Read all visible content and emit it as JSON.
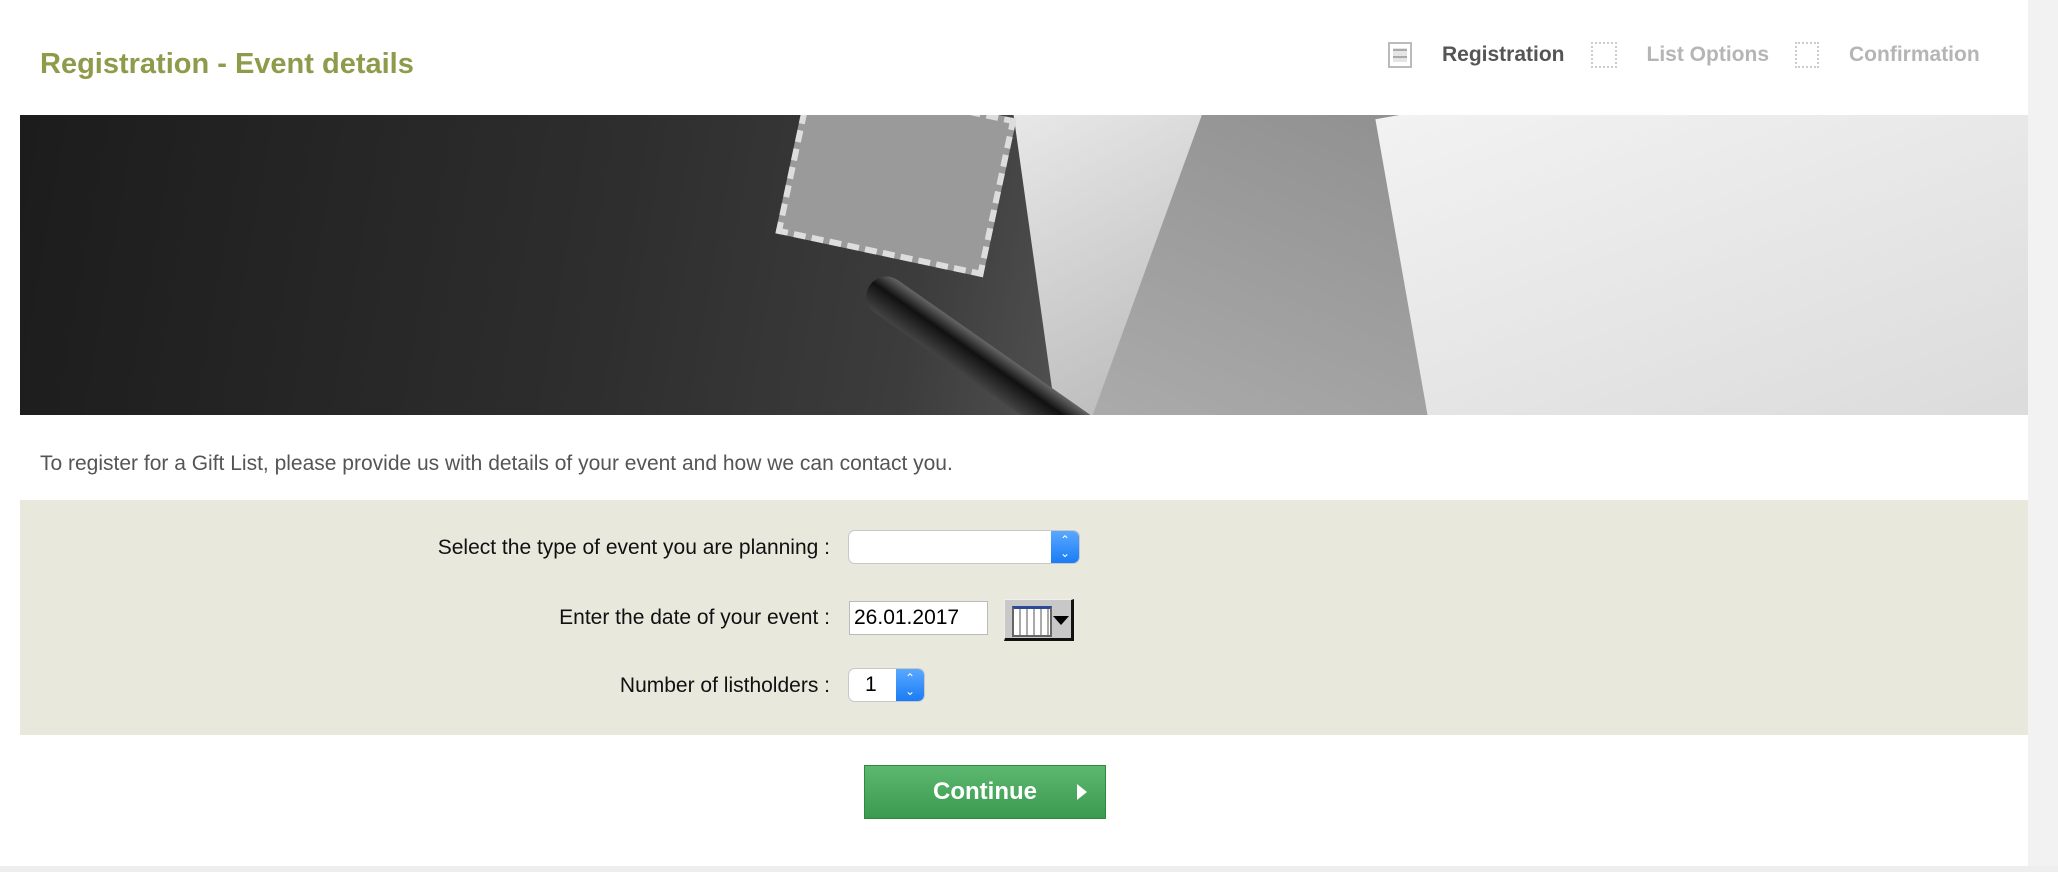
{
  "header": {
    "title": "Registration - Event details"
  },
  "steps": [
    {
      "label": "Registration",
      "icon": "document-icon",
      "active": true
    },
    {
      "label": "List Options",
      "icon": "grid-icon",
      "active": false
    },
    {
      "label": "Confirmation",
      "icon": "checkmark-icon",
      "active": false
    }
  ],
  "intro": "To register for a Gift List, please provide us with details of your event and how we can contact you.",
  "form": {
    "event_type_label": "Select the type of event you are planning :",
    "event_type_value": "",
    "date_label": "Enter the date of your event :",
    "date_value": "26.01.2017",
    "listholders_label": "Number of listholders :",
    "listholders_value": "1"
  },
  "continue_label": "Continue",
  "colors": {
    "title": "#8f9a4a",
    "panel": "#e8e8dd",
    "button": "#3f9f52",
    "select_arrow": "#1a7cf5"
  }
}
